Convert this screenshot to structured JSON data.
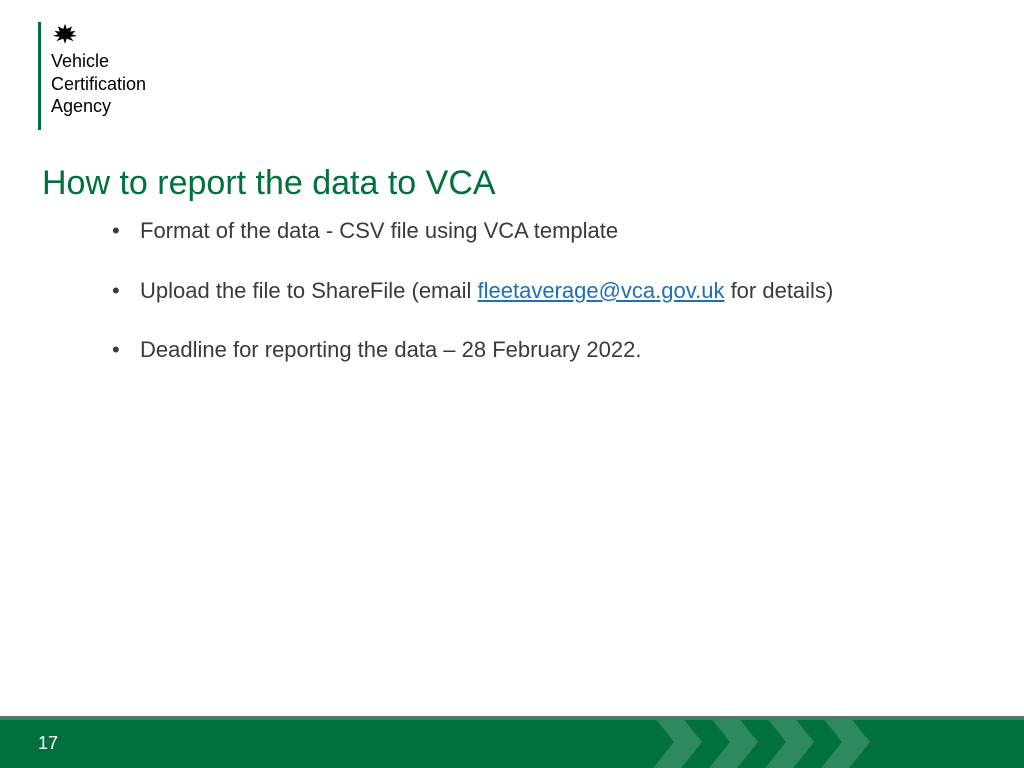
{
  "logo": {
    "line1": "Vehicle",
    "line2": "Certification",
    "line3": "Agency"
  },
  "title": "How to report the data to VCA",
  "bullets": {
    "b1": "Format of the data - CSV file using VCA template",
    "b2_before": "Upload the file to ShareFile (email ",
    "b2_link": "fleetaverage@vca.gov.uk",
    "b2_after": " for details)",
    "b3": "Deadline for reporting the data – 28 February 2022."
  },
  "page_number": "17"
}
